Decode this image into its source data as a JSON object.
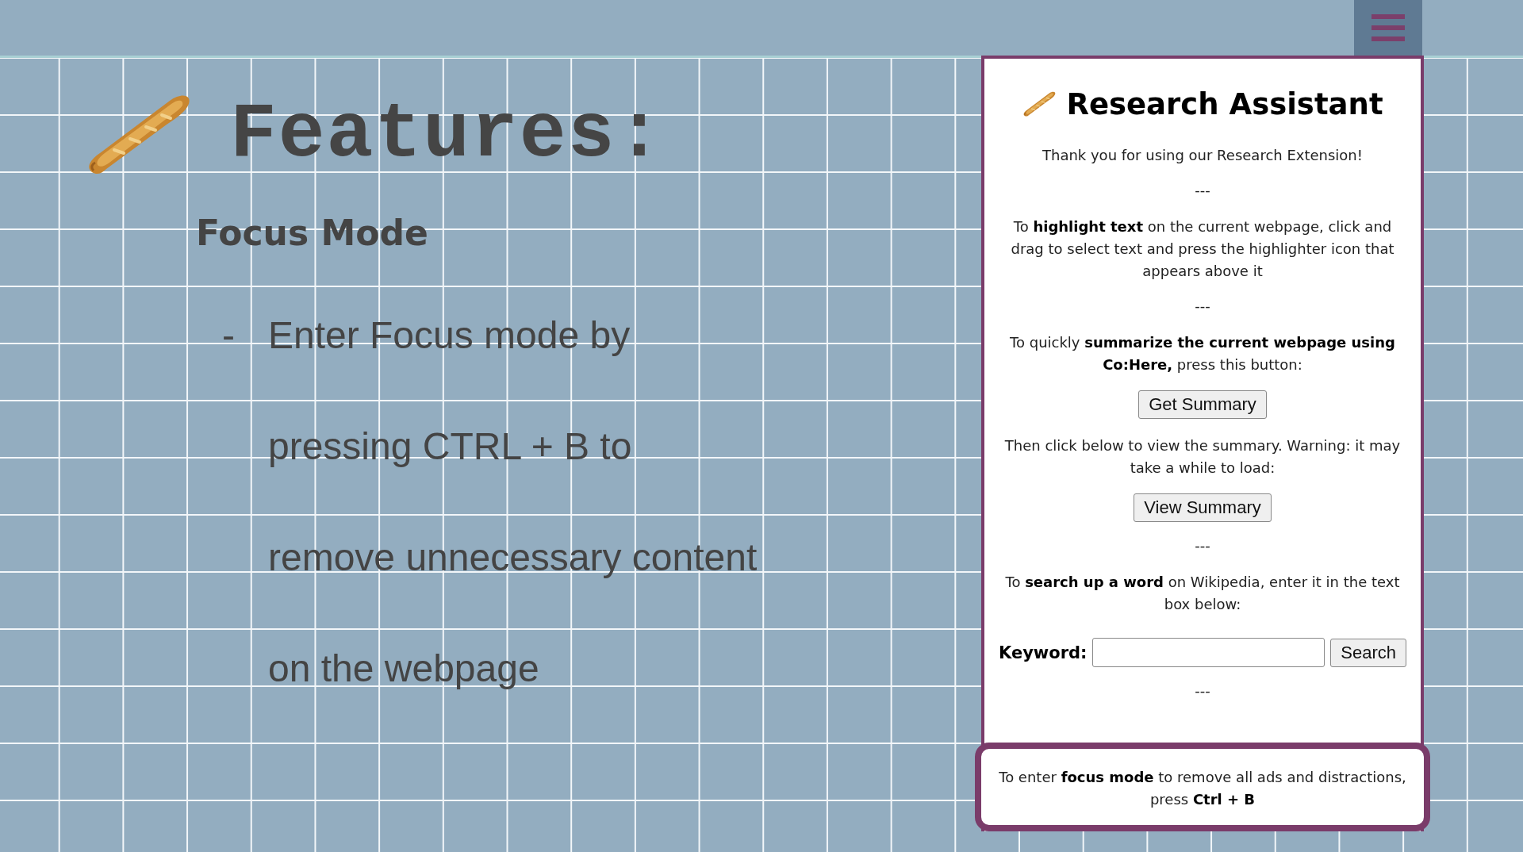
{
  "slide": {
    "title": "Features:",
    "heading": "Focus Mode",
    "bullets": [
      {
        "marker": "-",
        "text": "Enter Focus mode by pressing CTRL + B to remove unnecessary content on the webpage"
      }
    ]
  },
  "popup": {
    "title": "Research Assistant",
    "sections": [
      {
        "kind": "text",
        "text": "Thank you for using our Research Extension!"
      },
      {
        "kind": "divider",
        "text": "---"
      },
      {
        "kind": "text",
        "text": "To **highlight text** on the current webpage, click and drag to select text and press the highlighter icon that appears above it"
      },
      {
        "kind": "divider",
        "text": "---"
      },
      {
        "kind": "text",
        "text": "To quickly **summarize the current webpage using Co:Here,** press this button:"
      },
      {
        "kind": "button",
        "text": "Get Summary"
      },
      {
        "kind": "text",
        "text": "Then click below to view the summary. Warning: it may take a while to load:"
      },
      {
        "kind": "button",
        "text": "View Summary"
      },
      {
        "kind": "divider",
        "text": "---"
      },
      {
        "kind": "text",
        "text": "To **search up a word** on Wikipedia, enter it in the text box below:"
      },
      {
        "kind": "search",
        "label": "Keyword:",
        "button": "Search"
      },
      {
        "kind": "divider",
        "text": "---"
      }
    ],
    "callout": {
      "text": "To enter **focus mode** to remove all ads and distractions, press **Ctrl + B**"
    }
  }
}
